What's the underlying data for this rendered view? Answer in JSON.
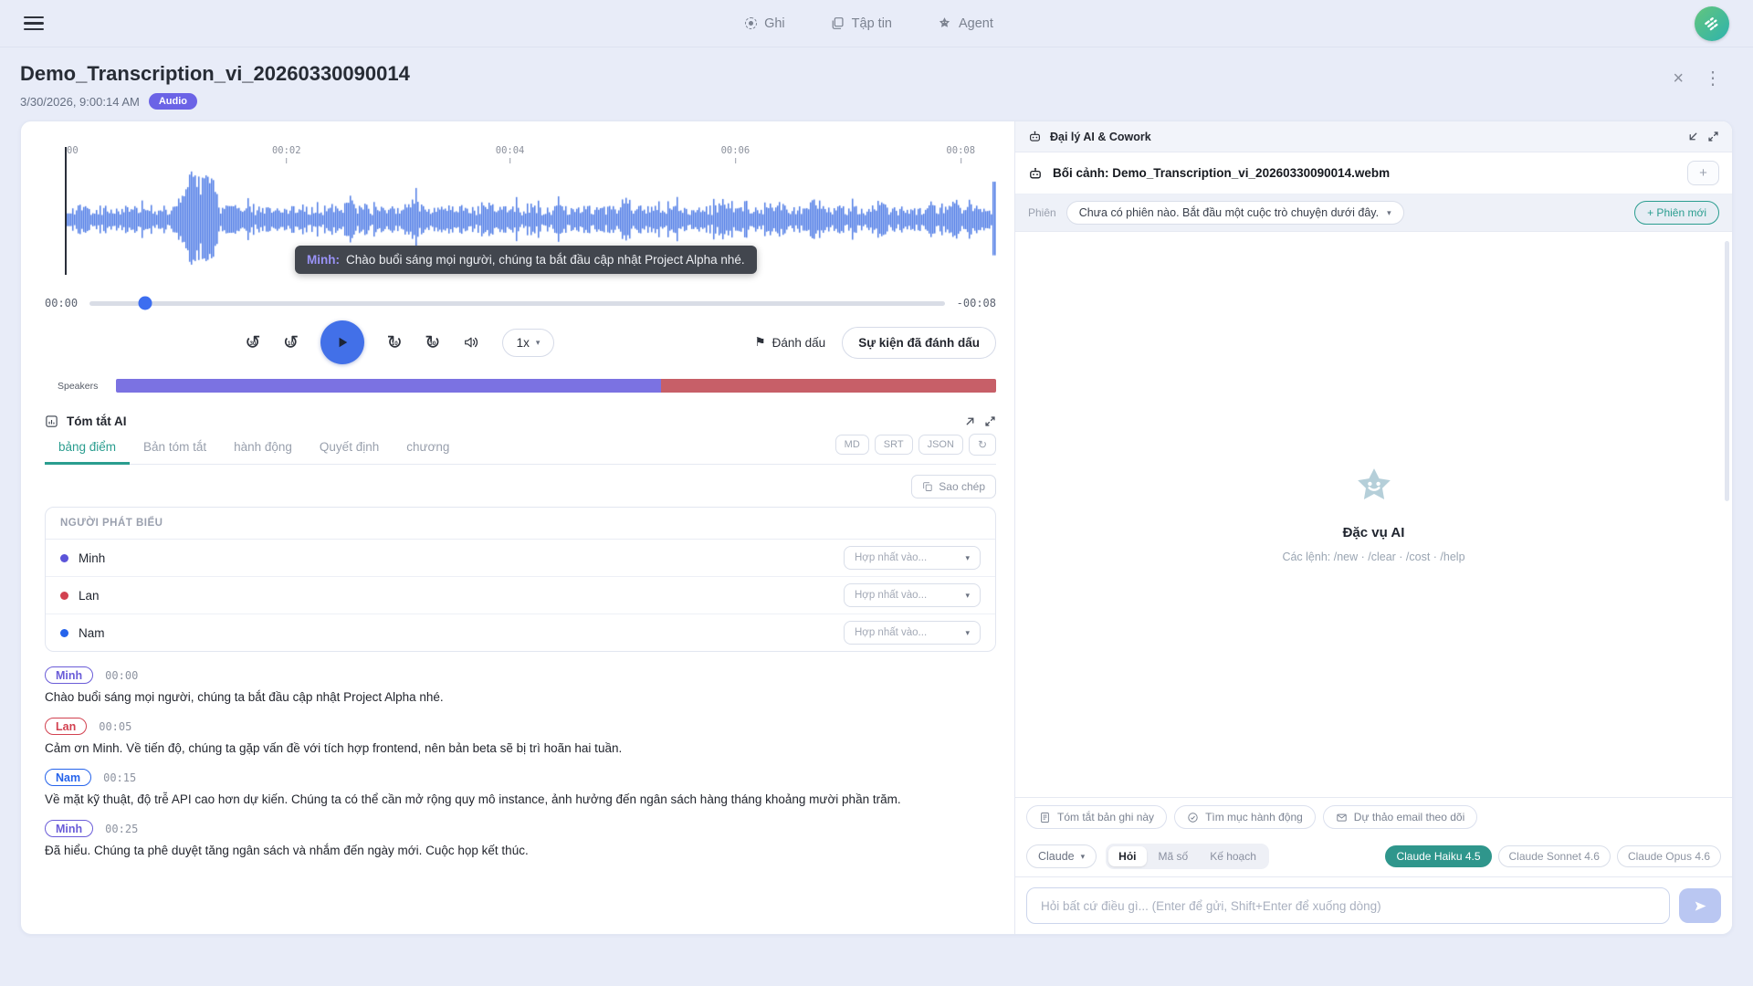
{
  "app": {
    "topbar": {
      "nav": [
        {
          "label": "Ghi",
          "icon": "record-icon"
        },
        {
          "label": "Tập tin",
          "icon": "files-icon"
        },
        {
          "label": "Agent",
          "icon": "agent-star-icon"
        }
      ]
    }
  },
  "header": {
    "title": "Demo_Transcription_vi_20260330090014",
    "date": "3/30/2026, 9:00:14 AM",
    "badge": "Audio"
  },
  "player": {
    "ruler_ticks": [
      {
        "label": "00",
        "pos_pct": 0
      },
      {
        "label": "00:02",
        "pos_pct": 23.8
      },
      {
        "label": "00:04",
        "pos_pct": 47.8
      },
      {
        "label": "00:06",
        "pos_pct": 72.0
      },
      {
        "label": "00:08",
        "pos_pct": 96.2
      }
    ],
    "waveform_color": "#4f7ce6",
    "tooltip": {
      "speaker": "Minh:",
      "text": "Chào buổi sáng mọi người, chúng ta bắt đầu cập nhật Project Alpha nhé."
    },
    "elapsed": "00:00",
    "remaining": "-00:08",
    "progress_pct": 6.5,
    "speed": "1x",
    "mark_label": "Đánh dấu",
    "marked_events_label": "Sự kiện đã đánh dấu",
    "speakers_label": "Speakers",
    "speaker_segments": [
      {
        "speaker": "Minh",
        "color": "#7b72e2",
        "width_pct": 61.9
      },
      {
        "speaker": "Lan",
        "color": "#c75f68",
        "width_pct": 38.1
      }
    ]
  },
  "summary": {
    "title": "Tóm tắt AI",
    "tabs": [
      "bảng điểm",
      "Bản tóm tắt",
      "hành động",
      "Quyết định",
      "chương"
    ],
    "active_tab": "bảng điểm",
    "accent_color": "#2a9d8f",
    "export_buttons": [
      "MD",
      "SRT",
      "JSON"
    ],
    "copy_label": "Sao chép",
    "speaker_table": {
      "header": "NGƯỜI PHÁT BIỂU",
      "merge_placeholder": "Hợp nhất vào...",
      "rows": [
        {
          "name": "Minh",
          "color": "#5b54d9"
        },
        {
          "name": "Lan",
          "color": "#d24150"
        },
        {
          "name": "Nam",
          "color": "#2563eb"
        }
      ]
    },
    "transcript": [
      {
        "speaker": "Minh",
        "time": "00:00",
        "color": "#6a5cd8",
        "text": "Chào buổi sáng mọi người, chúng ta bắt đầu cập nhật Project Alpha nhé."
      },
      {
        "speaker": "Lan",
        "time": "00:05",
        "color": "#d24150",
        "text": "Cảm ơn Minh. Về tiến độ, chúng ta gặp vấn đề với tích hợp frontend, nên bản beta sẽ bị trì hoãn hai tuần."
      },
      {
        "speaker": "Nam",
        "time": "00:15",
        "color": "#2563eb",
        "text": "Về mặt kỹ thuật, độ trễ API cao hơn dự kiến. Chúng ta có thể cần mở rộng quy mô instance, ảnh hưởng đến ngân sách hàng tháng khoảng mười phần trăm."
      },
      {
        "speaker": "Minh",
        "time": "00:25",
        "color": "#6a5cd8",
        "text": "Đã hiểu. Chúng ta phê duyệt tăng ngân sách và nhắm đến ngày mới. Cuộc họp kết thúc."
      }
    ]
  },
  "agent_panel": {
    "title": "Đại lý AI & Cowork",
    "context": "Bối cảnh: Demo_Transcription_vi_20260330090014.webm",
    "add_button": "+",
    "session_label": "Phiên",
    "session_value": "Chưa có phiên nào. Bắt đầu một cuộc trò chuyện dưới đây.",
    "new_session_label": "+ Phiên mới",
    "empty_state": {
      "title": "Đặc vụ AI",
      "commands": "Các lệnh: /new · /clear · /cost · /help"
    },
    "quick_actions": [
      {
        "label": "Tóm tắt bản ghi này",
        "icon": "doc-icon"
      },
      {
        "label": "Tìm mục hành động",
        "icon": "check-circle-icon"
      },
      {
        "label": "Dự thảo email theo dõi",
        "icon": "mail-icon"
      }
    ],
    "provider": "Claude",
    "modes": [
      "Hỏi",
      "Mã số",
      "Kế hoạch"
    ],
    "active_mode": "Hỏi",
    "models": [
      {
        "label": "Claude Haiku 4.5",
        "active": true
      },
      {
        "label": "Claude Sonnet 4.6",
        "active": false
      },
      {
        "label": "Claude Opus 4.6",
        "active": false
      }
    ],
    "model_active_color": "#2f968c",
    "input_placeholder": "Hỏi bất cứ điều gì... (Enter để gửi, Shift+Enter để xuống dòng)"
  }
}
